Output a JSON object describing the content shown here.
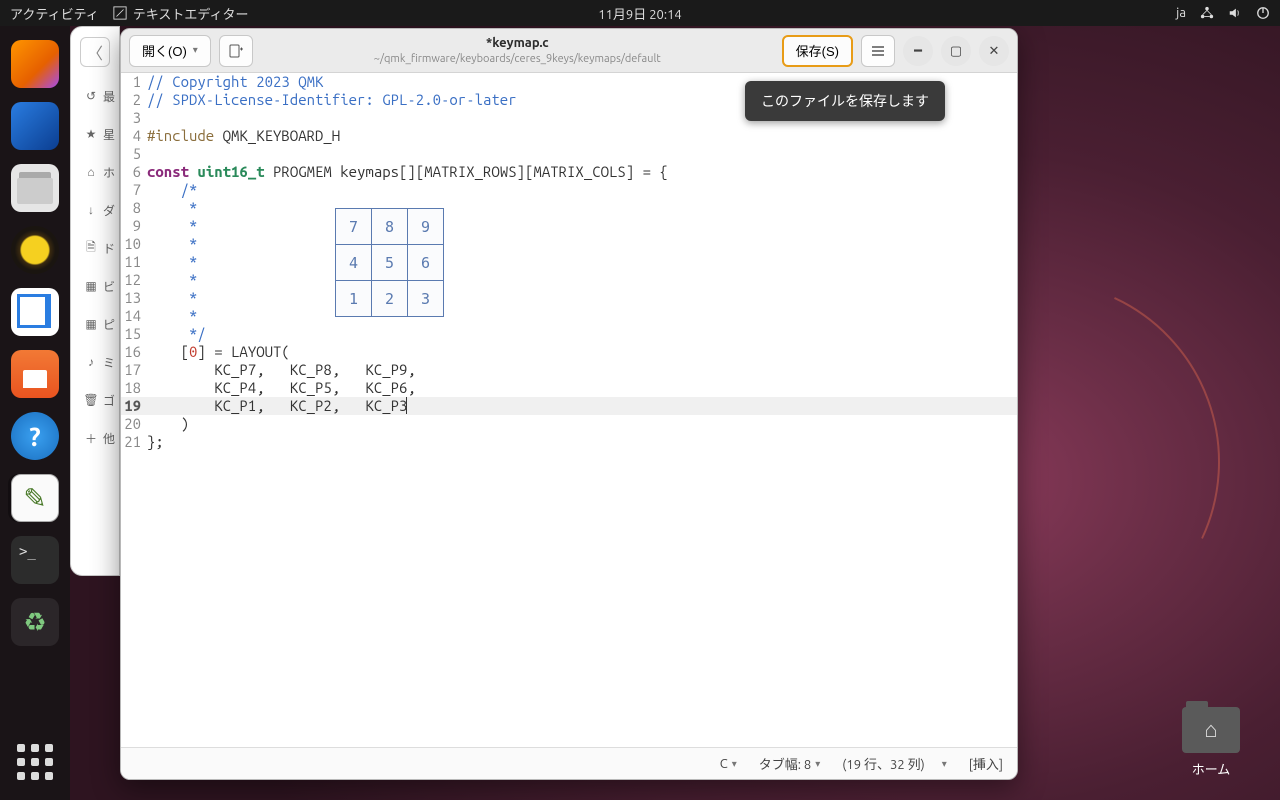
{
  "topbar": {
    "activities": "アクティビティ",
    "app_name": "テキストエディター",
    "datetime": "11月9日  20:14",
    "ime": "ja"
  },
  "desktop": {
    "home_label": "ホーム"
  },
  "sidebar_tray": {
    "items": [
      {
        "glyph": "↺",
        "label": "最"
      },
      {
        "glyph": "★",
        "label": "星"
      },
      {
        "glyph": "⌂",
        "label": "ホ"
      },
      {
        "glyph": "↓",
        "label": "ダ"
      },
      {
        "glyph": "🗎",
        "label": "ド"
      },
      {
        "glyph": "▦",
        "label": "ビ"
      },
      {
        "glyph": "▦",
        "label": "ピ"
      },
      {
        "glyph": "♪",
        "label": "ミ"
      },
      {
        "glyph": "🗑",
        "label": "ゴ"
      },
      {
        "glyph": "＋",
        "label": "他"
      }
    ]
  },
  "editor": {
    "open_label": "開く(O)",
    "save_label": "保存(S)",
    "filename": "*keymap.c",
    "filepath": "~/qmk_firmware/keyboards/ceres_9keys/keymaps/default",
    "tooltip": "このファイルを保存します",
    "status": {
      "lang": "C",
      "tab": "タブ幅: 8",
      "pos": "(19 行、32 列)",
      "mode": "[挿入]"
    },
    "keypad": [
      [
        "7",
        "8",
        "9"
      ],
      [
        "4",
        "5",
        "6"
      ],
      [
        "1",
        "2",
        "3"
      ]
    ],
    "code_lines": [
      {
        "n": 1,
        "html": "<span class='c-comment'>// Copyright 2023 QMK</span>"
      },
      {
        "n": 2,
        "html": "<span class='c-comment'>// SPDX-License-Identifier: GPL-2.0-or-later</span>"
      },
      {
        "n": 3,
        "html": ""
      },
      {
        "n": 4,
        "html": "<span class='c-preproc'>#include</span> QMK_KEYBOARD_H"
      },
      {
        "n": 5,
        "html": ""
      },
      {
        "n": 6,
        "html": "<span class='c-keyword'>const</span> <span class='c-type'>uint16_t</span> PROGMEM keymaps[][MATRIX_ROWS][MATRIX_COLS] = {"
      },
      {
        "n": 7,
        "html": "    <span class='c-comment'>/*</span>"
      },
      {
        "n": 8,
        "html": "     <span class='c-comment'>*</span>"
      },
      {
        "n": 9,
        "html": "     <span class='c-comment'>*</span>"
      },
      {
        "n": 10,
        "html": "     <span class='c-comment'>*</span>"
      },
      {
        "n": 11,
        "html": "     <span class='c-comment'>*</span>"
      },
      {
        "n": 12,
        "html": "     <span class='c-comment'>*</span>"
      },
      {
        "n": 13,
        "html": "     <span class='c-comment'>*</span>"
      },
      {
        "n": 14,
        "html": "     <span class='c-comment'>*</span>"
      },
      {
        "n": 15,
        "html": "     <span class='c-comment'>*/</span>"
      },
      {
        "n": 16,
        "html": "    [<span class='c-num'>0</span>] = LAYOUT("
      },
      {
        "n": 17,
        "html": "        KC_P7,   KC_P8,   KC_P9,"
      },
      {
        "n": 18,
        "html": "        KC_P4,   KC_P5,   KC_P6,"
      },
      {
        "n": 19,
        "html": "        KC_P1,   KC_P2,   KC_P3<span class='caret'></span>",
        "hl": true
      },
      {
        "n": 20,
        "html": "    )"
      },
      {
        "n": 21,
        "html": "};"
      }
    ]
  }
}
